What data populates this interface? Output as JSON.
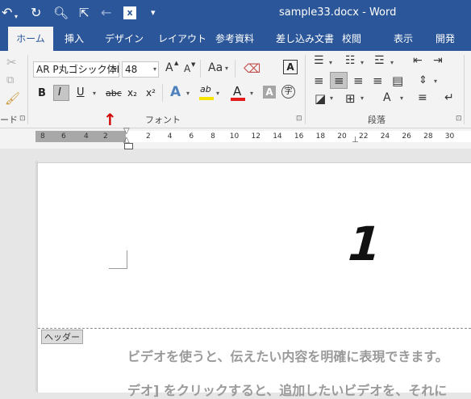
{
  "window": {
    "title": "sample33.docx  -  Word"
  },
  "quick_access": {
    "undo_icon": "undo-icon",
    "redo_icon": "redo-icon",
    "print_preview_icon": "print-preview-icon",
    "pointer_icon": "pointer-icon",
    "back_icon": "back-arrow-icon",
    "excel_icon": "excel-icon",
    "customize_icon": "customize-toolbar-icon"
  },
  "tabs": [
    {
      "label": "ホーム",
      "active": true
    },
    {
      "label": "挿入"
    },
    {
      "label": "デザイン"
    },
    {
      "label": "レイアウト"
    },
    {
      "label": "参考資料"
    },
    {
      "label": "差し込み文書"
    },
    {
      "label": "校閲"
    },
    {
      "label": "表示"
    },
    {
      "label": "開発"
    }
  ],
  "ribbon": {
    "clipboard": {
      "label": "ード",
      "launcher": "⊡"
    },
    "font": {
      "label": "フォント",
      "font_name": "AR P丸ゴシック体E",
      "font_size": "48",
      "grow": "A",
      "shrink": "A",
      "case": "Aa",
      "bold": "B",
      "italic": "I",
      "underline": "U",
      "strike": "abc",
      "subscript": "x₂",
      "superscript": "x²",
      "text_effect": "A",
      "highlight": "ab",
      "font_color": "A",
      "char_shade": "A",
      "enclose": "字",
      "launcher": "⊡"
    },
    "paragraph": {
      "label": "段落",
      "launcher": "⊡"
    },
    "colors": {
      "highlight": "#f5e400",
      "font_color": "#e31b1b",
      "accent": "#2b579a"
    }
  },
  "ruler": {
    "ticks_left": [
      "8",
      "6",
      "4",
      "2"
    ],
    "ticks_right": [
      "2",
      "4",
      "6",
      "8",
      "10",
      "12",
      "14",
      "16",
      "18",
      "20",
      "22",
      "24",
      "26",
      "28",
      "30"
    ]
  },
  "annotation": {
    "arrow": "↑"
  },
  "document": {
    "page_number": "1",
    "header_tag": "ヘッダー",
    "line1": "ビデオを使うと、伝えたい内容を明確に表現できます。",
    "line2": "デオ] をクリックすると、追加したいビデオを、それに"
  }
}
